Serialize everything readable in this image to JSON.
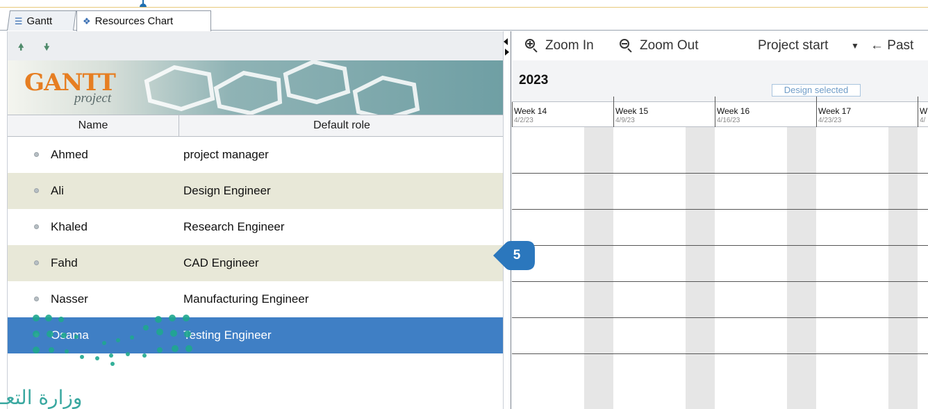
{
  "tabs": [
    {
      "label": "Gantt",
      "icon": "gantt-icon",
      "active": false
    },
    {
      "label": "Resources Chart",
      "icon": "resources-icon",
      "active": true
    }
  ],
  "left_toolbar": {
    "move_up_icon": "arrow-up-icon",
    "move_down_icon": "arrow-down-icon"
  },
  "logo": {
    "main": "GANTT",
    "sub": "project"
  },
  "table": {
    "headers": {
      "name": "Name",
      "role": "Default role"
    },
    "rows": [
      {
        "name": "Ahmed",
        "role": "project manager",
        "selected": false
      },
      {
        "name": "Ali",
        "role": "Design Engineer",
        "selected": false
      },
      {
        "name": "Khaled",
        "role": "Research Engineer",
        "selected": false
      },
      {
        "name": "Fahd",
        "role": "CAD Engineer",
        "selected": false
      },
      {
        "name": "Nasser",
        "role": "Manufacturing Engineer",
        "selected": false
      },
      {
        "name": "Osama",
        "role": "Testing Engineer",
        "selected": true
      }
    ]
  },
  "right_toolbar": {
    "zoom_in": "Zoom In",
    "zoom_out": "Zoom Out",
    "project_start": "Project start",
    "past": "← Past"
  },
  "timeline": {
    "year": "2023",
    "design_selected": "Design selected",
    "weeks": [
      {
        "label": "Week 14",
        "date": "4/2/23"
      },
      {
        "label": "Week 15",
        "date": "4/9/23"
      },
      {
        "label": "Week 16",
        "date": "4/16/23"
      },
      {
        "label": "Week 17",
        "date": "4/23/23"
      },
      {
        "label": "W",
        "date": "4/"
      }
    ]
  },
  "step_marker": "5",
  "watermark_text": "وزارة التعـ",
  "colors": {
    "selected_row": "#3f7fc5",
    "alt_row": "#e8e8d8",
    "step_marker": "#2b77bd",
    "watermark": "#3aa8a0"
  }
}
